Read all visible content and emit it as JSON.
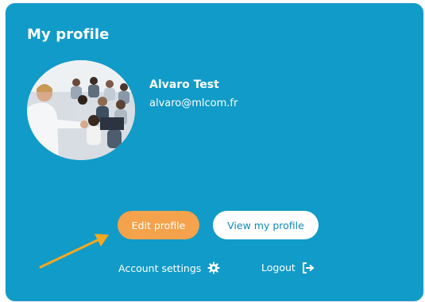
{
  "profile": {
    "title": "My profile",
    "user_name": "Alvaro Test",
    "user_email": "alvaro@mlcom.fr"
  },
  "actions": {
    "edit_label": "Edit profile",
    "view_label": "View my profile",
    "settings_label": "Account settings",
    "logout_label": "Logout"
  },
  "icons": {
    "settings": "gear-icon",
    "logout": "logout-icon",
    "annotation": "arrow-icon"
  },
  "colors": {
    "card_bg": "#119bc8",
    "edit_button": "#f4a24b",
    "view_button_text": "#1189bd",
    "annotation_arrow": "#f4a820"
  }
}
